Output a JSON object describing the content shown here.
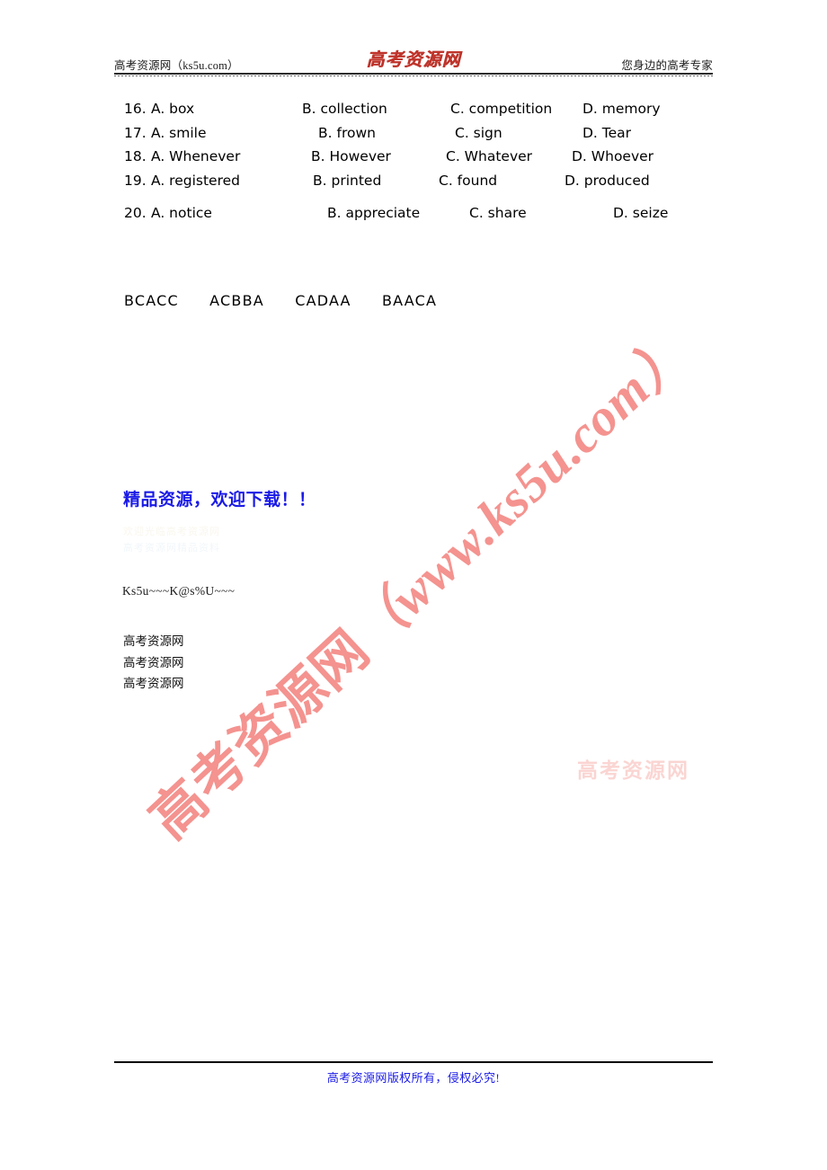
{
  "header": {
    "left_text": "高考资源网（ks5u.com）",
    "logo_text": "高考资源网",
    "right_text": "您身边的高考专家"
  },
  "questions": [
    {
      "number": "16.",
      "a": "A. box",
      "b": "B. collection",
      "c": "C. competition",
      "d": "D. memory"
    },
    {
      "number": "17.",
      "a": "A. smile",
      "b": "B. frown",
      "c": "C. sign",
      "d": "D. Tear"
    },
    {
      "number": "18.",
      "a": "A. Whenever",
      "b": "B. However",
      "c": "C. Whatever",
      "d": "D. Whoever"
    },
    {
      "number": "19.",
      "a": "A. registered",
      "b": "B. printed",
      "c": "C. found",
      "d": "D. produced"
    },
    {
      "number": "20.",
      "a": "A. notice",
      "b": "B. appreciate",
      "c": "C. share",
      "d": "D. seize"
    }
  ],
  "answer_key": {
    "groups": [
      "BCACC",
      "ACBBA",
      "CADAA",
      "BAACA"
    ]
  },
  "promo": {
    "heading": "精品资源，欢迎下载！！",
    "faint_line_1": "欢迎光临高考资源网",
    "faint_line_2": "高考资源网精品资料",
    "code": "Ks5u~~~K@s%U~~~",
    "brand_line_1": "高考资源网",
    "brand_line_2": "高考资源网",
    "brand_line_3": "高考资源网"
  },
  "watermark": {
    "main_cn": "高考资源网",
    "main_latin": "（www.ks5u.com）",
    "faint_text": "高考资源网",
    "color": "#f48e8a"
  },
  "footer": {
    "text": "高考资源网版权所有，侵权必究!",
    "color": "#1a1ae6"
  }
}
